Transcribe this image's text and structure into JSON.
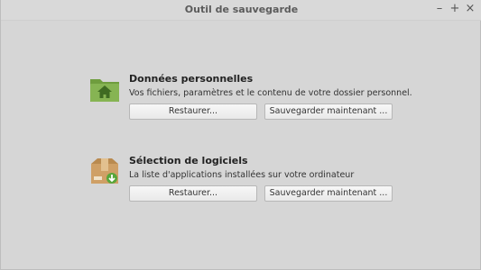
{
  "window": {
    "title": "Outil de sauvegarde",
    "minimize": "–",
    "maximize": "+",
    "close": "×"
  },
  "sections": [
    {
      "icon": "home-folder-icon",
      "heading": "Données personnelles",
      "description": "Vos fichiers, paramètres et le contenu de votre dossier personnel.",
      "restore_label": "Restaurer...",
      "backup_label": "Sauvegarder maintenant ..."
    },
    {
      "icon": "package-icon",
      "heading": "Sélection de logiciels",
      "description": "La liste d'applications installées sur votre ordinateur",
      "restore_label": "Restaurer...",
      "backup_label": "Sauvegarder maintenant ..."
    }
  ],
  "colors": {
    "folder": "#7fae4b",
    "package": "#c89a5c",
    "background": "#d6d6d6"
  }
}
